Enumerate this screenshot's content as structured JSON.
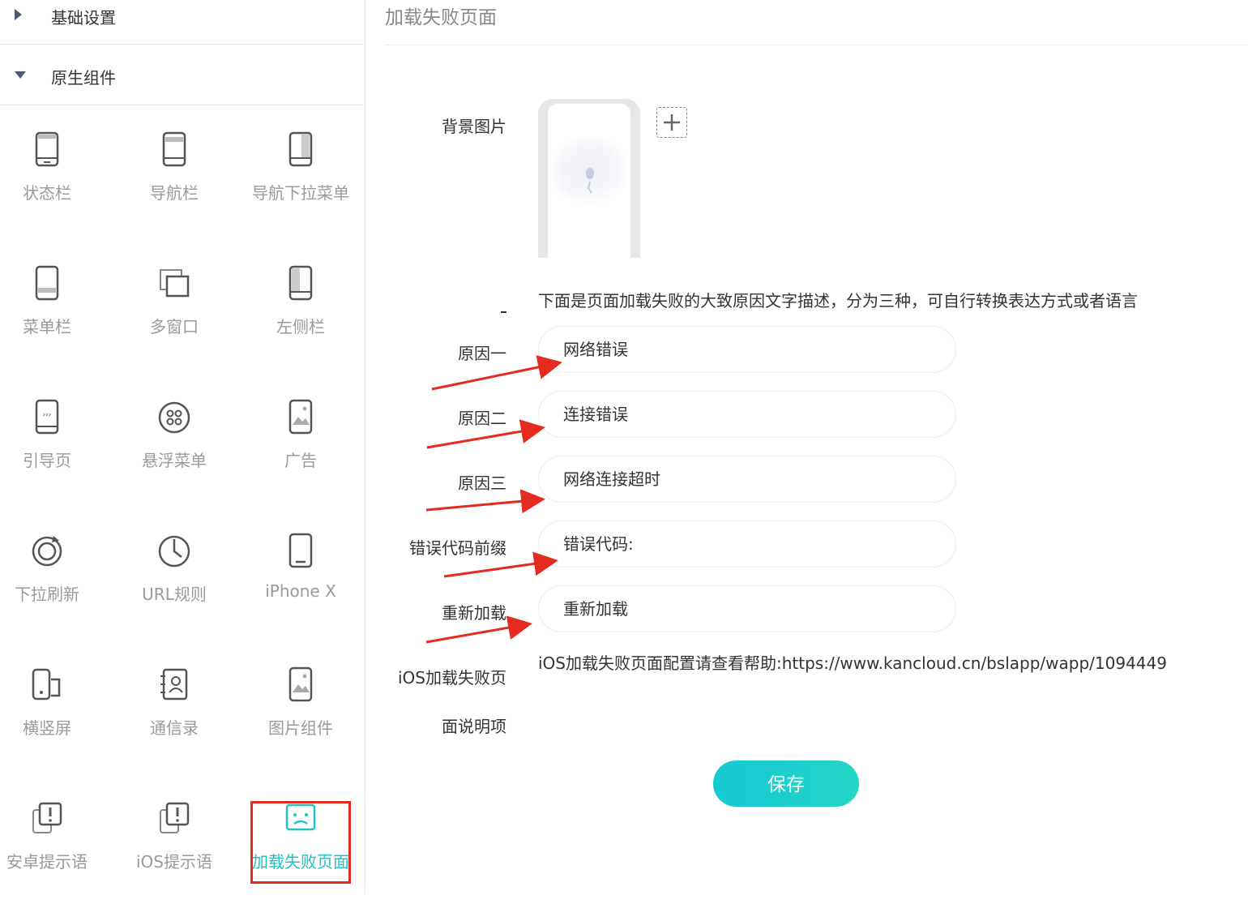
{
  "sidebar": {
    "sections": [
      {
        "label": "基础设置",
        "expanded": false
      },
      {
        "label": "原生组件",
        "expanded": true
      }
    ],
    "items": [
      {
        "label": "状态栏",
        "icon": "status-bar-icon"
      },
      {
        "label": "导航栏",
        "icon": "nav-bar-icon"
      },
      {
        "label": "导航下拉菜单",
        "icon": "nav-dropdown-icon"
      },
      {
        "label": "菜单栏",
        "icon": "menu-bar-icon"
      },
      {
        "label": "多窗口",
        "icon": "multi-window-icon"
      },
      {
        "label": "左侧栏",
        "icon": "left-sidebar-icon"
      },
      {
        "label": "引导页",
        "icon": "guide-page-icon"
      },
      {
        "label": "悬浮菜单",
        "icon": "floating-menu-icon"
      },
      {
        "label": "广告",
        "icon": "ad-icon"
      },
      {
        "label": "下拉刷新",
        "icon": "pull-refresh-icon"
      },
      {
        "label": "URL规则",
        "icon": "url-rule-icon"
      },
      {
        "label": "iPhone X",
        "icon": "iphone-x-icon"
      },
      {
        "label": "横竖屏",
        "icon": "orientation-icon"
      },
      {
        "label": "通信录",
        "icon": "contacts-icon"
      },
      {
        "label": "图片组件",
        "icon": "image-component-icon"
      },
      {
        "label": "安卓提示语",
        "icon": "android-tip-icon"
      },
      {
        "label": "iOS提示语",
        "icon": "ios-tip-icon"
      },
      {
        "label": "加载失败页面",
        "icon": "sad-face-icon",
        "active": true
      }
    ]
  },
  "main": {
    "title": "加载失败页面",
    "bg_label": "背景图片",
    "description": "下面是页面加载失败的大致原因文字描述，分为三种，可自行转换表达方式或者语言",
    "fields": [
      {
        "label": "原因一",
        "value": "网络错误"
      },
      {
        "label": "原因二",
        "value": "连接错误"
      },
      {
        "label": "原因三",
        "value": "网络连接超时"
      },
      {
        "label": "错误代码前缀",
        "value": "错误代码:"
      },
      {
        "label": "重新加载",
        "value": "重新加载"
      }
    ],
    "ios_label_line1": "iOS加载失败页",
    "ios_label_line2": "面说明项",
    "help_text": "iOS加载失败页面配置请查看帮助:https://www.kancloud.cn/bslapp/wapp/1094449",
    "save_label": "保存"
  },
  "colors": {
    "accent": "#22c1c3",
    "annotation": "#e52a1f"
  }
}
